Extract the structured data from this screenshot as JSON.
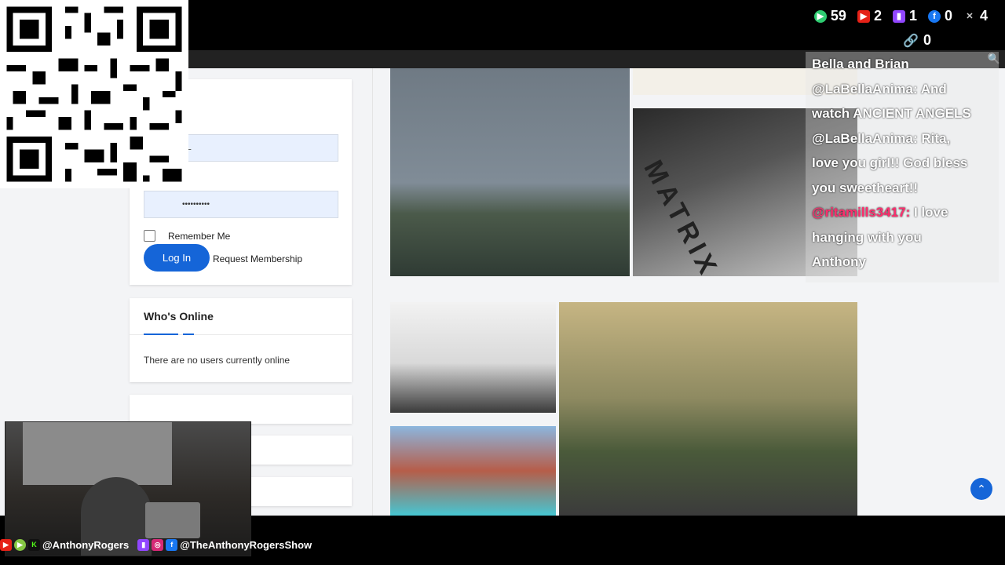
{
  "stream_stats": {
    "viewers": "59",
    "youtube": "2",
    "twitch": "1",
    "facebook": "0",
    "x": "4",
    "links": "0"
  },
  "login": {
    "username_value": "TL",
    "password_value": "••••••••••",
    "remember_label": "Remember Me",
    "login_button": "Log In",
    "request_link": "Request Membership"
  },
  "whos_online": {
    "title": "Who's Online",
    "text": "There are no users currently online"
  },
  "gallery": {
    "matrix_brand": "MATRIX"
  },
  "chat": {
    "lines": [
      {
        "user": "",
        "text": "Bella and Brian"
      },
      {
        "user": "",
        "text": "@LaBellaAnima: And"
      },
      {
        "user": "",
        "text": "watch ANCIENT ANGELS"
      },
      {
        "user": "",
        "text": "@LaBellaAnima: Rita,"
      },
      {
        "user": "",
        "text": "love you girl!! God bless"
      },
      {
        "user": "",
        "text": "you sweetheart!!"
      },
      {
        "user": "@ritamills3417:",
        "text": " I love"
      },
      {
        "user": "",
        "text": "hanging with you"
      },
      {
        "user": "",
        "text": "Anthony"
      }
    ]
  },
  "footer": {
    "handle_1": "@AnthonyRogers",
    "handle_2": "@TheAnthonyRogersShow"
  },
  "colors": {
    "accent": "#1565d8",
    "chat_user": "#ff2e6e"
  }
}
